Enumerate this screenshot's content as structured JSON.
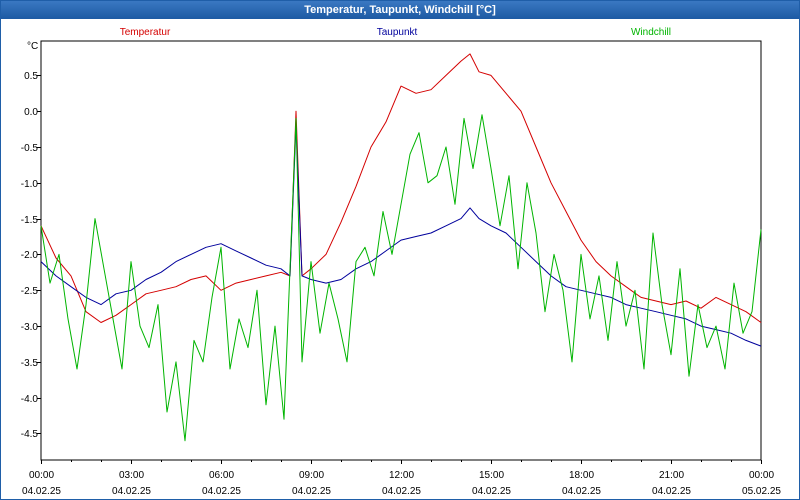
{
  "window": {
    "title": "Temperatur, Taupunkt, Windchill [°C]"
  },
  "chart_data": {
    "type": "line",
    "title": "Temperatur, Taupunkt, Windchill [°C]",
    "ylabel": "°C",
    "xlabel": "",
    "ylim": [
      -4.87,
      0.98
    ],
    "xlim_hours": [
      0,
      24
    ],
    "grid": true,
    "grid_style": "dashed",
    "legend_placement": "top",
    "y_ticks": [
      0.5,
      0.0,
      -0.5,
      -1.0,
      -1.5,
      -2.0,
      -2.5,
      -3.0,
      -3.5,
      -4.0,
      -4.5
    ],
    "y_tick_labels": [
      "0.5",
      "0.0",
      "-0.5",
      "-1.0",
      "-1.5",
      "-2.0",
      "-2.5",
      "-3.0",
      "-3.5",
      "-4.0",
      "-4.5"
    ],
    "x_ticks": [
      {
        "hour": 0,
        "time": "00:00",
        "date": "04.02.25"
      },
      {
        "hour": 3,
        "time": "03:00",
        "date": "04.02.25"
      },
      {
        "hour": 6,
        "time": "06:00",
        "date": "04.02.25"
      },
      {
        "hour": 9,
        "time": "09:00",
        "date": "04.02.25"
      },
      {
        "hour": 12,
        "time": "12:00",
        "date": "04.02.25"
      },
      {
        "hour": 15,
        "time": "15:00",
        "date": "04.02.25"
      },
      {
        "hour": 18,
        "time": "18:00",
        "date": "04.02.25"
      },
      {
        "hour": 21,
        "time": "21:00",
        "date": "04.02.25"
      },
      {
        "hour": 24,
        "time": "00:00",
        "date": "05.02.25"
      }
    ],
    "series": [
      {
        "name": "Temperatur",
        "color": "#d40000",
        "x": [
          0,
          0.5,
          1,
          1.5,
          2,
          2.5,
          3,
          3.5,
          4,
          4.5,
          5,
          5.5,
          6,
          6.5,
          7,
          7.5,
          8,
          8.3,
          8.5,
          8.7,
          9,
          9.5,
          10,
          10.5,
          11,
          11.5,
          12,
          12.5,
          13,
          13.5,
          14,
          14.3,
          14.6,
          15,
          15.5,
          16,
          16.5,
          17,
          17.5,
          18,
          18.5,
          19,
          19.5,
          20,
          20.5,
          21,
          21.5,
          22,
          22.5,
          23,
          23.5,
          24
        ],
        "y": [
          -1.6,
          -2.05,
          -2.3,
          -2.8,
          -2.95,
          -2.85,
          -2.7,
          -2.55,
          -2.5,
          -2.45,
          -2.35,
          -2.3,
          -2.5,
          -2.4,
          -2.35,
          -2.3,
          -2.25,
          -2.3,
          0.0,
          -2.3,
          -2.2,
          -2.0,
          -1.55,
          -1.05,
          -0.5,
          -0.15,
          0.35,
          0.25,
          0.3,
          0.5,
          0.7,
          0.8,
          0.55,
          0.5,
          0.25,
          0.0,
          -0.5,
          -1.0,
          -1.4,
          -1.8,
          -2.1,
          -2.3,
          -2.45,
          -2.6,
          -2.65,
          -2.7,
          -2.65,
          -2.75,
          -2.6,
          -2.7,
          -2.8,
          -2.95
        ]
      },
      {
        "name": "Taupunkt",
        "color": "#00009c",
        "x": [
          0,
          0.5,
          1,
          1.5,
          2,
          2.5,
          3,
          3.5,
          4,
          4.5,
          5,
          5.5,
          6,
          6.5,
          7,
          7.5,
          8,
          8.3,
          8.5,
          8.7,
          9,
          9.5,
          10,
          10.5,
          11,
          11.5,
          12,
          12.5,
          13,
          13.5,
          14,
          14.3,
          14.6,
          15,
          15.5,
          16,
          16.5,
          17,
          17.5,
          18,
          18.5,
          19,
          19.5,
          20,
          20.5,
          21,
          21.5,
          22,
          22.5,
          23,
          23.5,
          24
        ],
        "y": [
          -2.1,
          -2.3,
          -2.45,
          -2.6,
          -2.7,
          -2.55,
          -2.5,
          -2.35,
          -2.25,
          -2.1,
          -2.0,
          -1.9,
          -1.85,
          -1.95,
          -2.05,
          -2.15,
          -2.2,
          -2.3,
          -0.2,
          -2.3,
          -2.35,
          -2.4,
          -2.35,
          -2.2,
          -2.1,
          -1.95,
          -1.8,
          -1.75,
          -1.7,
          -1.6,
          -1.5,
          -1.35,
          -1.5,
          -1.6,
          -1.7,
          -1.9,
          -2.1,
          -2.3,
          -2.45,
          -2.5,
          -2.55,
          -2.6,
          -2.7,
          -2.75,
          -2.8,
          -2.85,
          -2.9,
          -3.0,
          -3.05,
          -3.1,
          -3.2,
          -3.28
        ]
      },
      {
        "name": "Windchill",
        "color": "#00b400",
        "x": [
          0,
          0.3,
          0.6,
          0.9,
          1.2,
          1.5,
          1.8,
          2.1,
          2.4,
          2.7,
          3.0,
          3.3,
          3.6,
          3.9,
          4.2,
          4.5,
          4.8,
          5.1,
          5.4,
          5.7,
          6.0,
          6.3,
          6.6,
          6.9,
          7.2,
          7.5,
          7.8,
          8.1,
          8.3,
          8.5,
          8.7,
          9.0,
          9.3,
          9.6,
          9.9,
          10.2,
          10.5,
          10.8,
          11.1,
          11.4,
          11.7,
          12.0,
          12.3,
          12.6,
          12.9,
          13.2,
          13.5,
          13.8,
          14.1,
          14.4,
          14.7,
          15.0,
          15.3,
          15.6,
          15.9,
          16.2,
          16.5,
          16.8,
          17.1,
          17.4,
          17.7,
          18.0,
          18.3,
          18.6,
          18.9,
          19.2,
          19.5,
          19.8,
          20.1,
          20.4,
          20.7,
          21.0,
          21.3,
          21.6,
          21.9,
          22.2,
          22.5,
          22.8,
          23.1,
          23.4,
          23.7,
          24.0
        ],
        "y": [
          -1.6,
          -2.4,
          -2.0,
          -2.9,
          -3.6,
          -2.7,
          -1.5,
          -2.2,
          -2.9,
          -3.6,
          -2.1,
          -3.0,
          -3.3,
          -2.7,
          -4.2,
          -3.5,
          -4.6,
          -3.2,
          -3.5,
          -2.6,
          -1.9,
          -3.6,
          -2.9,
          -3.3,
          -2.5,
          -4.1,
          -3.0,
          -4.3,
          -2.2,
          -0.1,
          -3.5,
          -2.1,
          -3.1,
          -2.4,
          -2.9,
          -3.5,
          -2.1,
          -1.9,
          -2.3,
          -1.4,
          -2.0,
          -1.3,
          -0.6,
          -0.3,
          -1.0,
          -0.9,
          -0.5,
          -1.3,
          -0.1,
          -0.8,
          -0.05,
          -0.8,
          -1.6,
          -0.9,
          -2.2,
          -1.0,
          -1.7,
          -2.8,
          -2.0,
          -2.5,
          -3.5,
          -2.0,
          -2.9,
          -2.3,
          -3.2,
          -2.1,
          -3.0,
          -2.5,
          -3.6,
          -1.7,
          -2.7,
          -3.4,
          -2.2,
          -3.7,
          -2.7,
          -3.3,
          -3.0,
          -3.6,
          -2.4,
          -3.1,
          -2.8,
          -1.65
        ]
      }
    ]
  }
}
